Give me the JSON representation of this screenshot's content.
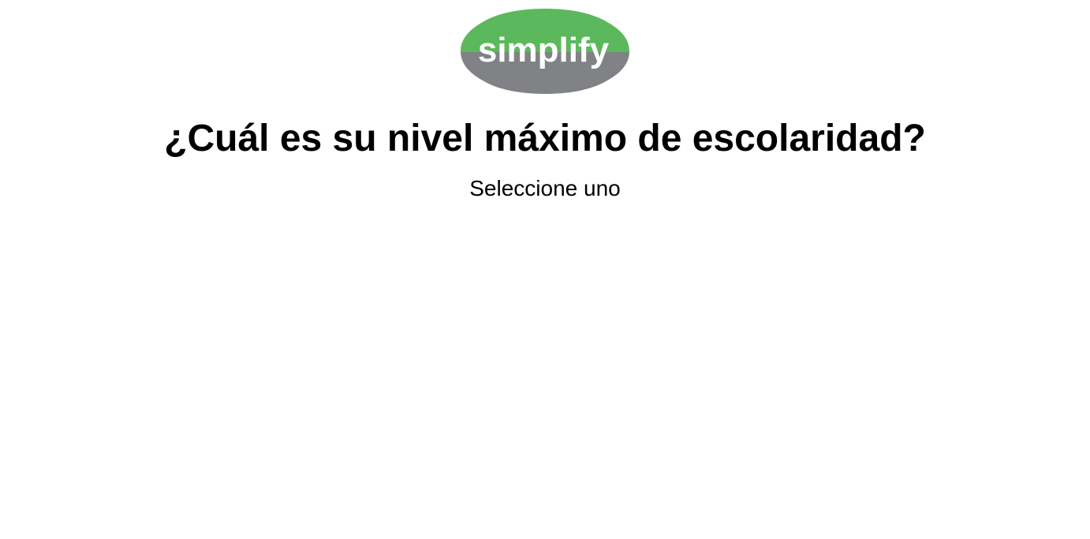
{
  "logo": {
    "text": "simplify",
    "colors": {
      "top": "#5cb85c",
      "bottom": "#808285",
      "text": "#ffffff"
    }
  },
  "question": {
    "title": "¿Cuál es su nivel máximo de escolaridad?",
    "instruction": "Seleccione uno"
  }
}
